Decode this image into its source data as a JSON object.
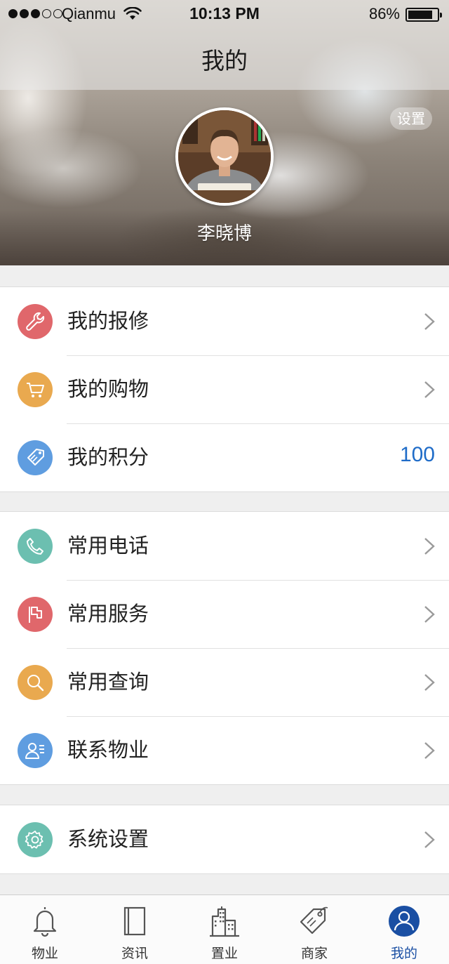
{
  "status_bar": {
    "carrier": "Qianmu",
    "time": "10:13 PM",
    "battery_percent": "86%",
    "battery_level": 0.86,
    "signal_bars_filled": 3,
    "signal_bars_total": 5
  },
  "header": {
    "title": "我的",
    "settings_label": "设置"
  },
  "profile": {
    "name": "李晓博"
  },
  "colors": {
    "red": "#e0676b",
    "orange": "#e9a94f",
    "blue": "#5f9de0",
    "teal": "#6cbfb0",
    "link_blue": "#1f6cc8",
    "active_tab": "#1a4fa3"
  },
  "groups": [
    {
      "items": [
        {
          "label": "我的报修",
          "icon": "wrench-icon",
          "color": "#e0676b",
          "value": null
        },
        {
          "label": "我的购物",
          "icon": "cart-icon",
          "color": "#e9a94f",
          "value": null
        },
        {
          "label": "我的积分",
          "icon": "tag-icon",
          "color": "#5f9de0",
          "value": "100"
        }
      ]
    },
    {
      "items": [
        {
          "label": "常用电话",
          "icon": "phone-icon",
          "color": "#6cbfb0"
        },
        {
          "label": "常用服务",
          "icon": "flag-icon",
          "color": "#e0676b"
        },
        {
          "label": "常用查询",
          "icon": "search-icon",
          "color": "#e9a94f"
        },
        {
          "label": "联系物业",
          "icon": "contact-icon",
          "color": "#5f9de0"
        }
      ]
    },
    {
      "items": [
        {
          "label": "系统设置",
          "icon": "gear-icon",
          "color": "#6cbfb0"
        }
      ]
    }
  ],
  "tabs": [
    {
      "label": "物业",
      "icon": "bell-icon",
      "active": false
    },
    {
      "label": "资讯",
      "icon": "book-icon",
      "active": false
    },
    {
      "label": "置业",
      "icon": "building-icon",
      "active": false
    },
    {
      "label": "商家",
      "icon": "price-tag-icon",
      "active": false
    },
    {
      "label": "我的",
      "icon": "user-icon",
      "active": true
    }
  ]
}
